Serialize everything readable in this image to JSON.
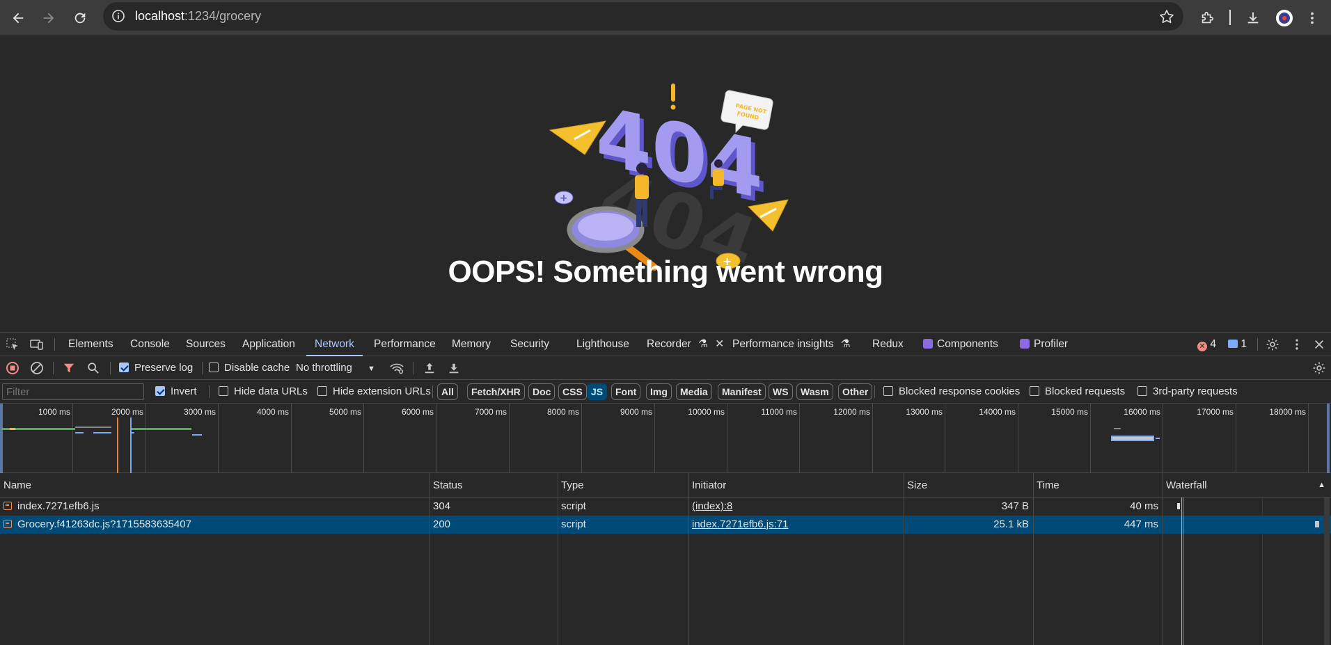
{
  "browser": {
    "url_host": "localhost",
    "url_rest": ":1234/grocery"
  },
  "page": {
    "headline": "OOPS! Something went wrong",
    "illustration": {
      "big_number": "404",
      "speech_bubble": "PAGE NOT FOUND"
    }
  },
  "devtools": {
    "tabs": [
      {
        "label": "Elements"
      },
      {
        "label": "Console"
      },
      {
        "label": "Sources"
      },
      {
        "label": "Application"
      },
      {
        "label": "Network",
        "active": true
      },
      {
        "label": "Performance"
      },
      {
        "label": "Memory"
      },
      {
        "label": "Security"
      },
      {
        "label": "Lighthouse"
      },
      {
        "label": "Recorder"
      },
      {
        "label": "Performance insights"
      },
      {
        "label": "Redux"
      },
      {
        "label": "Components"
      },
      {
        "label": "Profiler"
      }
    ],
    "error_count": "4",
    "message_count": "1",
    "toolbar": {
      "preserve_log": "Preserve log",
      "preserve_log_checked": true,
      "disable_cache": "Disable cache",
      "disable_cache_checked": false,
      "throttling": "No throttling"
    },
    "filterbar": {
      "filter_placeholder": "Filter",
      "invert": "Invert",
      "invert_checked": true,
      "hide_data_urls": "Hide data URLs",
      "hide_extension_urls": "Hide extension URLs",
      "types": [
        "All",
        "Fetch/XHR",
        "Doc",
        "CSS",
        "JS",
        "Font",
        "Img",
        "Media",
        "Manifest",
        "WS",
        "Wasm",
        "Other"
      ],
      "active_type": "JS",
      "blocked_response_cookies": "Blocked response cookies",
      "blocked_requests": "Blocked requests",
      "third_party": "3rd-party requests"
    },
    "overview_ticks": [
      "1000 ms",
      "2000 ms",
      "3000 ms",
      "4000 ms",
      "5000 ms",
      "6000 ms",
      "7000 ms",
      "8000 ms",
      "9000 ms",
      "10000 ms",
      "11000 ms",
      "12000 ms",
      "13000 ms",
      "14000 ms",
      "15000 ms",
      "16000 ms",
      "17000 ms",
      "18000 ms"
    ],
    "columns": [
      "Name",
      "Status",
      "Type",
      "Initiator",
      "Size",
      "Time",
      "Waterfall"
    ],
    "rows": [
      {
        "name": "index.7271efb6.js",
        "status": "304",
        "type": "script",
        "initiator": "(index):8",
        "size": "347 B",
        "time": "40 ms"
      },
      {
        "name": "Grocery.f41263dc.js?1715583635407",
        "status": "200",
        "type": "script",
        "initiator": "index.7271efb6.js:71",
        "size": "25.1 kB",
        "time": "447 ms",
        "selected": true
      }
    ],
    "colors": {
      "accent": "#a8c7fa",
      "selected_row": "#004a77",
      "record": "#f28b82"
    }
  }
}
